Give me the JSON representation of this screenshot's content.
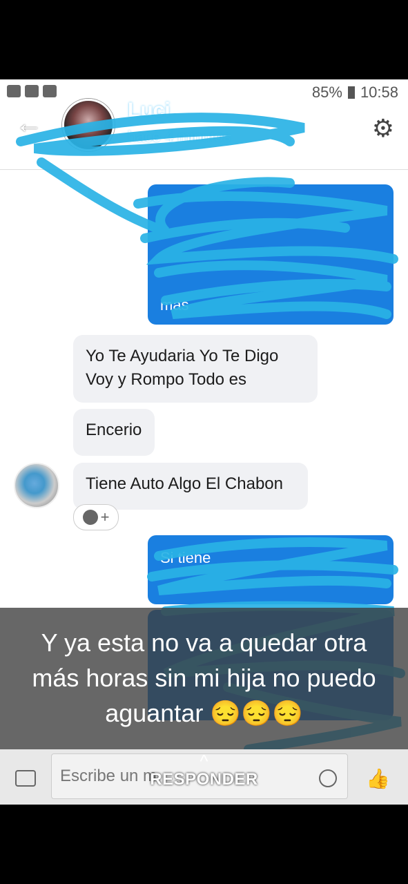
{
  "status": {
    "battery": "85%",
    "time": "10:58"
  },
  "header": {
    "name": "Luci",
    "subtitle": "hace 4 minutos"
  },
  "messages": {
    "out1_visible": "mas",
    "in1": "Yo Te Ayudaria Yo Te Digo Voy y Rompo Todo es",
    "in2": "Encerio",
    "in3": "Tiene Auto Algo El Chabon",
    "out2_visible": "Si tiene"
  },
  "reaction": {
    "plus": "+"
  },
  "overlay": {
    "line1": "Y ya esta no va a quedar otra",
    "line2": "más horas sin mi hija no puedo",
    "line3": "aguantar 😔😔😔"
  },
  "composer": {
    "placeholder": "Escribe un m",
    "responder": "RESPONDER",
    "chevron": "^"
  },
  "icons": [
    "back-arrow-icon",
    "gear-icon",
    "camera-icon",
    "emoji-icon",
    "thumbs-up-icon"
  ]
}
